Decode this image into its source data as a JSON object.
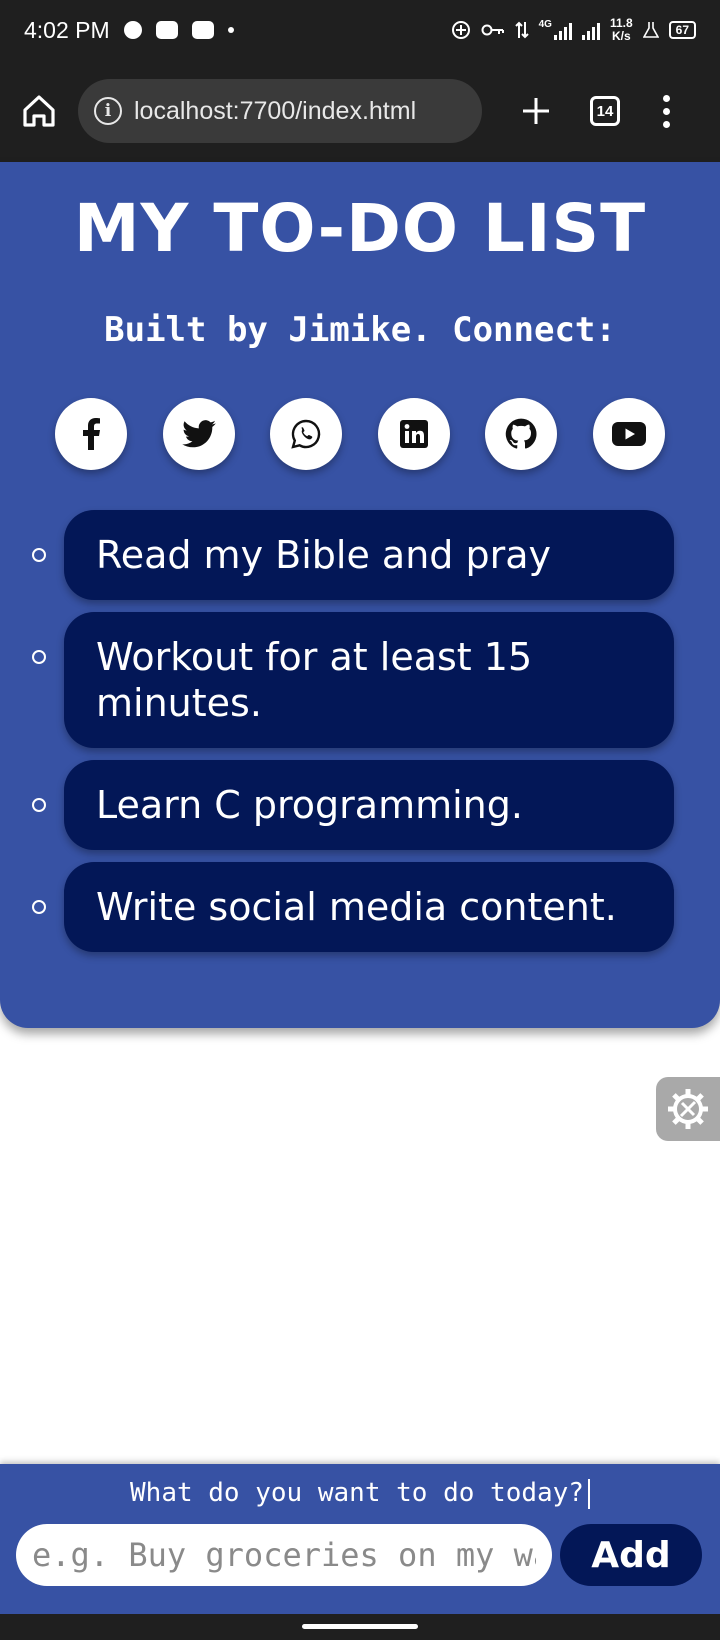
{
  "status_bar": {
    "time": "4:02 PM",
    "network": "4G",
    "speed_value": "11.8",
    "speed_unit": "K/s",
    "battery": "67"
  },
  "browser": {
    "url": "localhost:7700/index.html",
    "tab_count": "14",
    "icons": [
      "home-icon",
      "info-icon",
      "plus-icon",
      "tabs-icon",
      "more-vert-icon"
    ]
  },
  "page": {
    "title": "MY TO-DO LIST",
    "subtitle": "Built by Jimike. Connect:",
    "socials": [
      "facebook-icon",
      "twitter-icon",
      "whatsapp-icon",
      "linkedin-icon",
      "github-icon",
      "youtube-icon"
    ],
    "todos": [
      "Read my Bible and pray",
      "Workout for at least 15 minutes.",
      "Learn C programming.",
      "Write social media content."
    ]
  },
  "input_panel": {
    "prompt": "What do you want to do today?",
    "placeholder": "e.g. Buy groceries on my way home",
    "add_label": "Add"
  },
  "colors": {
    "card_blue": "#3752a4",
    "item_navy": "#031757",
    "system_bar": "#1f1f1f"
  }
}
